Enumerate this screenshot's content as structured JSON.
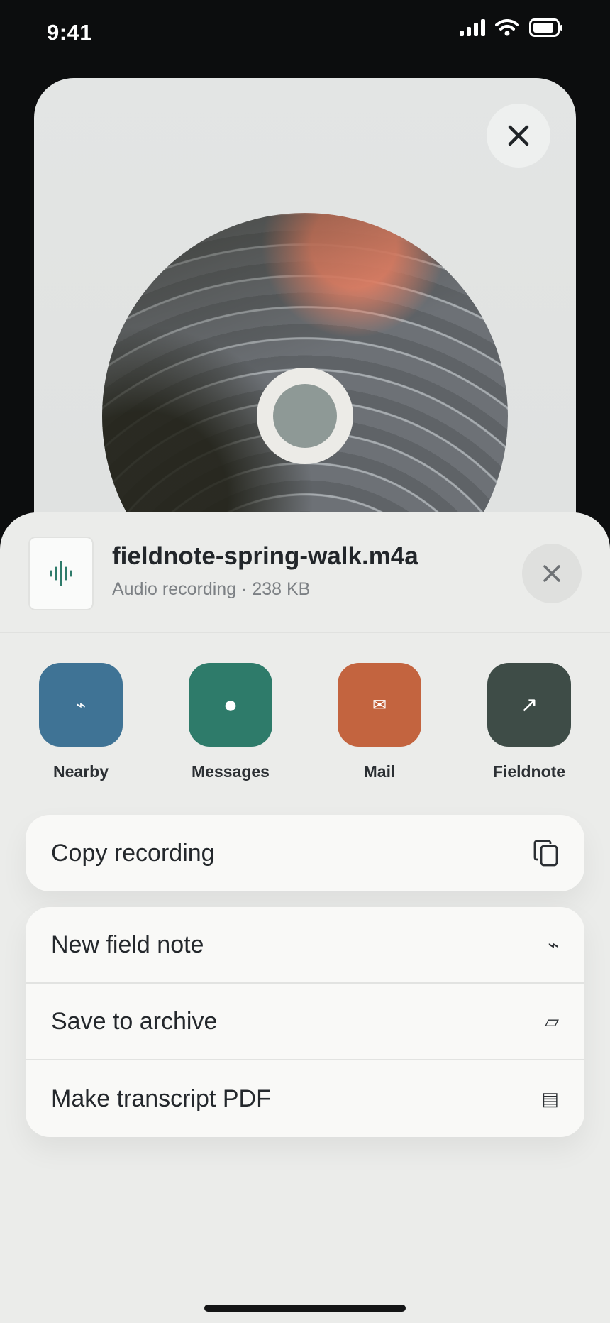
{
  "status": {
    "time": "9:41",
    "icons": [
      "signal-icon",
      "wifi-icon",
      "battery-icon"
    ]
  },
  "preview": {
    "close_icon": "close-icon"
  },
  "file": {
    "name": "fieldnote-spring-walk.m4a",
    "meta": "Audio recording · 238 KB",
    "icon": "waveform-icon"
  },
  "apps": [
    {
      "label": "Nearby",
      "glyph": "⌁",
      "color": "#3f7395"
    },
    {
      "label": "Messages",
      "glyph": "●",
      "color": "#2e7b6a"
    },
    {
      "label": "Mail",
      "glyph": "✉",
      "color": "#c3643f"
    },
    {
      "label": "Fieldnote",
      "glyph": "↗",
      "color": "#3e4c47"
    }
  ],
  "actions_primary": [
    {
      "label": "Copy recording",
      "icon": "copy-icon"
    }
  ],
  "actions_secondary": [
    {
      "label": "New field note",
      "glyph": "⌁"
    },
    {
      "label": "Save to archive",
      "glyph": "▱"
    },
    {
      "label": "Make transcript PDF",
      "glyph": "▤"
    }
  ]
}
